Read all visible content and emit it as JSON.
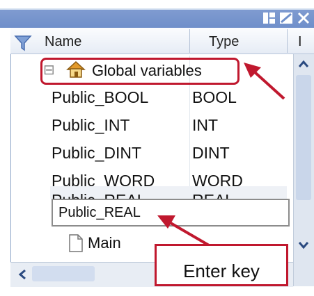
{
  "header": {
    "name_label": "Name",
    "type_label": "Type",
    "extra_label": "I"
  },
  "tree": {
    "root_label": "Global variables",
    "expander": "⊟",
    "rows": [
      {
        "name": "Public_BOOL",
        "type": "BOOL"
      },
      {
        "name": "Public_INT",
        "type": "INT"
      },
      {
        "name": "Public_DINT",
        "type": "DINT"
      },
      {
        "name": "Public_WORD",
        "type": "WORD"
      },
      {
        "name": "Public_REAL",
        "type": "REAL"
      }
    ],
    "main_label": "Main"
  },
  "editor": {
    "value": "Public_REAL"
  },
  "annotation": {
    "enter_key_label": "Enter key"
  },
  "colors": {
    "callout": "#c0182e",
    "titlebar": "#6f8fca"
  }
}
